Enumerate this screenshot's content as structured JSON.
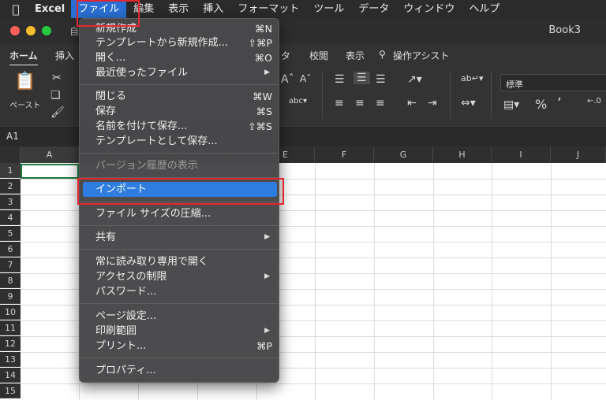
{
  "menubar": {
    "app": "Excel",
    "items": [
      "ファイル",
      "編集",
      "表示",
      "挿入",
      "フォーマット",
      "ツール",
      "データ",
      "ウィンドウ",
      "ヘルプ"
    ]
  },
  "window": {
    "title": "Book3",
    "autosave": "自"
  },
  "ribbon_tabs": [
    "ホーム",
    "挿入",
    "タ",
    "校閲",
    "表示",
    "操作アシスト"
  ],
  "ribbon": {
    "paste_label": "ペースト",
    "number_format": "標準"
  },
  "name_box": "A1",
  "columns": [
    "A",
    "B",
    "C",
    "D",
    "E",
    "F",
    "G",
    "H",
    "I",
    "J"
  ],
  "rows": [
    "1",
    "2",
    "3",
    "4",
    "5",
    "6",
    "7",
    "8",
    "9",
    "10",
    "11",
    "12",
    "13",
    "14",
    "15"
  ],
  "file_menu": {
    "groups": [
      [
        {
          "label": "新規作成",
          "shortcut": "⌘N"
        },
        {
          "label": "テンプレートから新規作成...",
          "shortcut": "⇧⌘P"
        },
        {
          "label": "開く...",
          "shortcut": "⌘O"
        },
        {
          "label": "最近使ったファイル",
          "submenu": true
        }
      ],
      [
        {
          "label": "閉じる",
          "shortcut": "⌘W"
        },
        {
          "label": "保存",
          "shortcut": "⌘S"
        },
        {
          "label": "名前を付けて保存...",
          "shortcut": "⇧⌘S"
        },
        {
          "label": "テンプレートとして保存..."
        }
      ],
      [
        {
          "label": "バージョン履歴の表示",
          "disabled": true
        }
      ],
      [
        {
          "label": "インポート",
          "highlighted": true
        }
      ],
      [
        {
          "label": "ファイル サイズの圧縮..."
        }
      ],
      [
        {
          "label": "共有",
          "submenu": true
        }
      ],
      [
        {
          "label": "常に読み取り専用で開く"
        },
        {
          "label": "アクセスの制限",
          "submenu": true
        },
        {
          "label": "パスワード..."
        }
      ],
      [
        {
          "label": "ページ設定..."
        },
        {
          "label": "印刷範囲",
          "submenu": true
        },
        {
          "label": "プリント...",
          "shortcut": "⌘P"
        }
      ],
      [
        {
          "label": "プロパティ..."
        }
      ]
    ]
  },
  "colors": {
    "highlight": "#2f7de1",
    "annotation": "#e3262f",
    "selection": "#1d7a3e"
  }
}
